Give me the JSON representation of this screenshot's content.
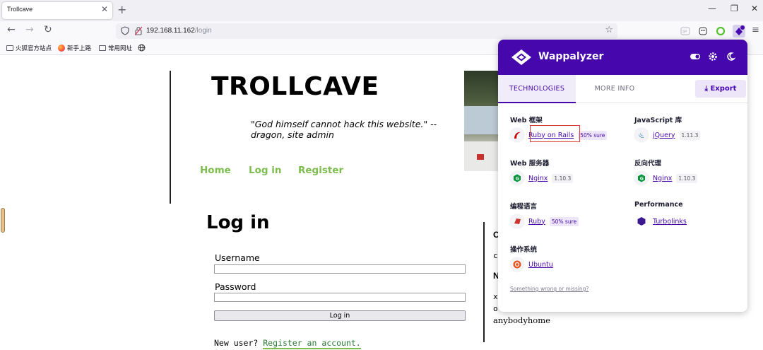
{
  "browser": {
    "tab_title": "Trollcave",
    "tab_close": "✕",
    "new_tab": "+",
    "url_host": "192.168.11.162",
    "url_path": "/login",
    "window_controls": [
      "—",
      "❐",
      "✕"
    ],
    "bookmarks": [
      "火狐官方站点",
      "新手上路",
      "常用网址"
    ]
  },
  "page": {
    "site_title": "TROLLCAVE",
    "quote": "\"God himself cannot hack this website.\" -- dragon, site admin",
    "nav": [
      "Home",
      "Log in",
      "Register"
    ],
    "login_heading": "Log in",
    "username_label": "Username",
    "password_label": "Password",
    "login_button": "Log in",
    "new_user_text": "New user?",
    "register_link": "Register an account.",
    "side_letters": [
      "C",
      "c",
      "N",
      "x",
      "o"
    ],
    "side_text": "anybodyhome"
  },
  "wappalyzer": {
    "title": "Wappalyzer",
    "tabs": [
      "TECHNOLOGIES",
      "MORE INFO"
    ],
    "export_label": "Export",
    "categories": [
      {
        "name": "Web 框架",
        "techs": [
          {
            "name": "Ruby on Rails",
            "sure": "50% sure",
            "icon": "rails-icon"
          }
        ]
      },
      {
        "name": "JavaScript 库",
        "techs": [
          {
            "name": "jQuery",
            "version": "1.11.3",
            "icon": "jquery-icon"
          }
        ]
      },
      {
        "name": "Web 服务器",
        "techs": [
          {
            "name": "Nginx",
            "version": "1.10.3",
            "icon": "nginx-icon"
          }
        ]
      },
      {
        "name": "反向代理",
        "techs": [
          {
            "name": "Nginx",
            "version": "1.10.3",
            "icon": "nginx-icon"
          }
        ]
      },
      {
        "name": "编程语言",
        "techs": [
          {
            "name": "Ruby",
            "sure": "50% sure",
            "icon": "ruby-icon"
          }
        ]
      },
      {
        "name": "Performance",
        "techs": [
          {
            "name": "Turbolinks",
            "icon": "turbolinks-icon"
          }
        ]
      },
      {
        "name": "操作系统",
        "techs": [
          {
            "name": "Ubuntu",
            "icon": "ubuntu-icon"
          }
        ]
      }
    ],
    "footer_link": "Something wrong or missing?",
    "colors": {
      "brand": "#4608ad",
      "highlight": "#e23b3b"
    }
  },
  "colors": {
    "nav_green": "#7cbd4c"
  }
}
